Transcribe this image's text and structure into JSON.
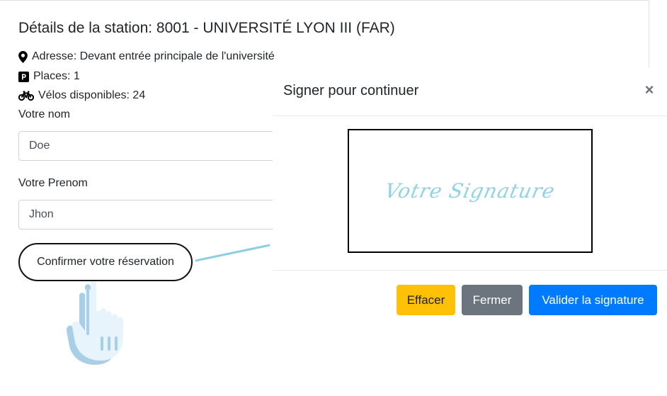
{
  "station": {
    "title": "Détails de la station: 8001 - UNIVERSITÉ LYON III (FAR)",
    "address": "Adresse: Devant entrée principale de l'université",
    "places": "Places: 1",
    "bikes": "Vélos disponibles: 24"
  },
  "form": {
    "lastname_label": "Votre nom",
    "lastname_value": "Doe",
    "firstname_label": "Votre Prenom",
    "firstname_value": "Jhon",
    "confirm_label": "Confirmer votre réservation"
  },
  "modal": {
    "title": "Signer pour continuer",
    "close_symbol": "×",
    "signature_placeholder": "Votre Signature",
    "buttons": {
      "clear": "Effacer",
      "close": "Fermer",
      "validate": "Valider la signature"
    }
  },
  "colors": {
    "warning": "#ffc107",
    "secondary": "#6c757d",
    "primary": "#007bff",
    "signature_text": "#8fd3e8",
    "connector": "#8ccfe0"
  },
  "icons": {
    "address": "map-marker-icon",
    "places": "parking-icon",
    "bikes": "bicycle-icon",
    "pointer": "pointing-hand-icon"
  }
}
